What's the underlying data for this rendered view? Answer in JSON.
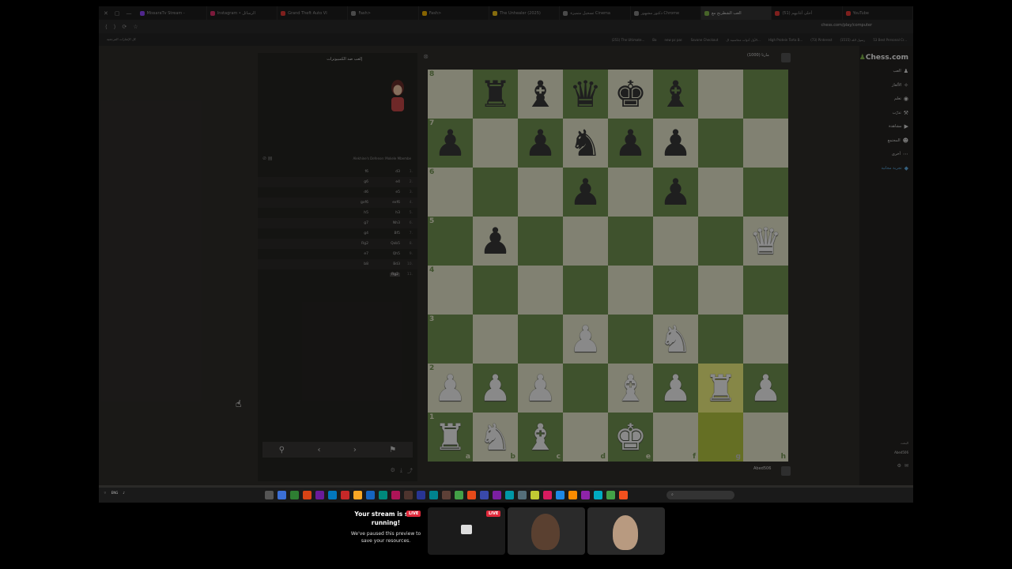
{
  "browser": {
    "tabs": [
      {
        "label": "MissaraTv Stream -",
        "color": "#9146ff"
      },
      {
        "label": "Instagram • الرسائل",
        "color": "#e1306c"
      },
      {
        "label": "Grand Theft Auto VI",
        "color": "#e53935"
      },
      {
        "label": "Fash>",
        "color": "#888888"
      },
      {
        "label": "Fash>",
        "color": "#f4b400"
      },
      {
        "label": "The Unhealer (2025)",
        "color": "#f5c518"
      },
      {
        "label": "تسجيل متميزة Cinema",
        "color": "#888888"
      },
      {
        "label": "دكتور مشهور Chrome",
        "color": "#888888"
      },
      {
        "label": "العب الشطرنج مع",
        "color": "#81b64c",
        "active": true
      },
      {
        "label": "(51) أحلى أغانيهم",
        "color": "#e53935"
      },
      {
        "label": "YouTube",
        "color": "#e53935"
      }
    ],
    "url": "chess.com/play/computer",
    "bookmarks_left": "كل الإشارات المرجعية",
    "bookmarks": [
      "(251) The Ultimate...",
      "Ba",
      "new pc par.",
      "Savane Checkout",
      "الأول أدوات محاسبية ال...",
      "High Protein Torta B...",
      "(73) Pinterest",
      "(1515) رسول الله",
      "53 Best Personal Cr..."
    ]
  },
  "panel": {
    "title": "إلعب ضد الكمبيوترات",
    "opening": "Alekhine's Defense: Mokele Mbembe",
    "moves": [
      {
        "n": "1.",
        "w": "d3",
        "b": "f6"
      },
      {
        "n": "2.",
        "w": "e4",
        "b": "g6"
      },
      {
        "n": "3.",
        "w": "e5",
        "b": "d6"
      },
      {
        "n": "4.",
        "w": "exf6",
        "b": "gxf6"
      },
      {
        "n": "5.",
        "w": "h3",
        "b": "h5"
      },
      {
        "n": "6.",
        "w": "Nh3",
        "b": "g7"
      },
      {
        "n": "7.",
        "w": "Bf5",
        "b": "g4"
      },
      {
        "n": "8.",
        "w": "Qxb5",
        "b": "Rg2"
      },
      {
        "n": "9.",
        "w": "Qh5",
        "b": "e7"
      },
      {
        "n": "10.",
        "w": "Bd3",
        "b": "b8"
      },
      {
        "n": "11.",
        "w": "Rg2",
        "b": ""
      }
    ]
  },
  "board": {
    "opponent": "مارتا (1000)",
    "player": "Abed506",
    "highlight_squares": [
      "g2",
      "g1"
    ],
    "files": [
      "a",
      "b",
      "c",
      "d",
      "e",
      "f",
      "g",
      "h"
    ],
    "ranks": [
      "8",
      "7",
      "6",
      "5",
      "4",
      "3",
      "2",
      "1"
    ],
    "position": [
      [
        "",
        "br",
        "bb",
        "bq",
        "bk",
        "bb",
        "",
        ""
      ],
      [
        "bp",
        "",
        "bp",
        "bn",
        "bp",
        "bp",
        "",
        ""
      ],
      [
        "",
        "",
        "",
        "bp",
        "",
        "bp",
        "",
        ""
      ],
      [
        "",
        "bp",
        "",
        "",
        "",
        "",
        "",
        "wq"
      ],
      [
        "",
        "",
        "",
        "",
        "",
        "",
        "",
        ""
      ],
      [
        "",
        "",
        "",
        "wp",
        "",
        "wn",
        "",
        ""
      ],
      [
        "wp",
        "wp",
        "wp",
        "",
        "wb",
        "wp",
        "wr",
        "wp"
      ],
      [
        "wr",
        "wn",
        "wb",
        "",
        "wk",
        "",
        "",
        ""
      ]
    ]
  },
  "nav": {
    "logo": "Chess.com",
    "items": [
      {
        "label": "العب",
        "icon": "play-icon"
      },
      {
        "label": "الألغاز",
        "icon": "puzzle-icon"
      },
      {
        "label": "تعلم",
        "icon": "learn-icon"
      },
      {
        "label": "تدرّب",
        "icon": "train-icon"
      },
      {
        "label": "مشاهدة",
        "icon": "watch-icon"
      },
      {
        "label": "المجتمع",
        "icon": "community-icon"
      },
      {
        "label": "أخرى",
        "icon": "more-icon"
      },
      {
        "label": "تجربة مجانية",
        "icon": "diamond-icon"
      }
    ],
    "search": "البحث",
    "username": "Abed506"
  },
  "taskbar": {
    "lang": "ENG"
  },
  "stream": {
    "title": "Your stream is still running!",
    "subtitle": "We've paused this preview to save your resources.",
    "live": "LIVE"
  }
}
